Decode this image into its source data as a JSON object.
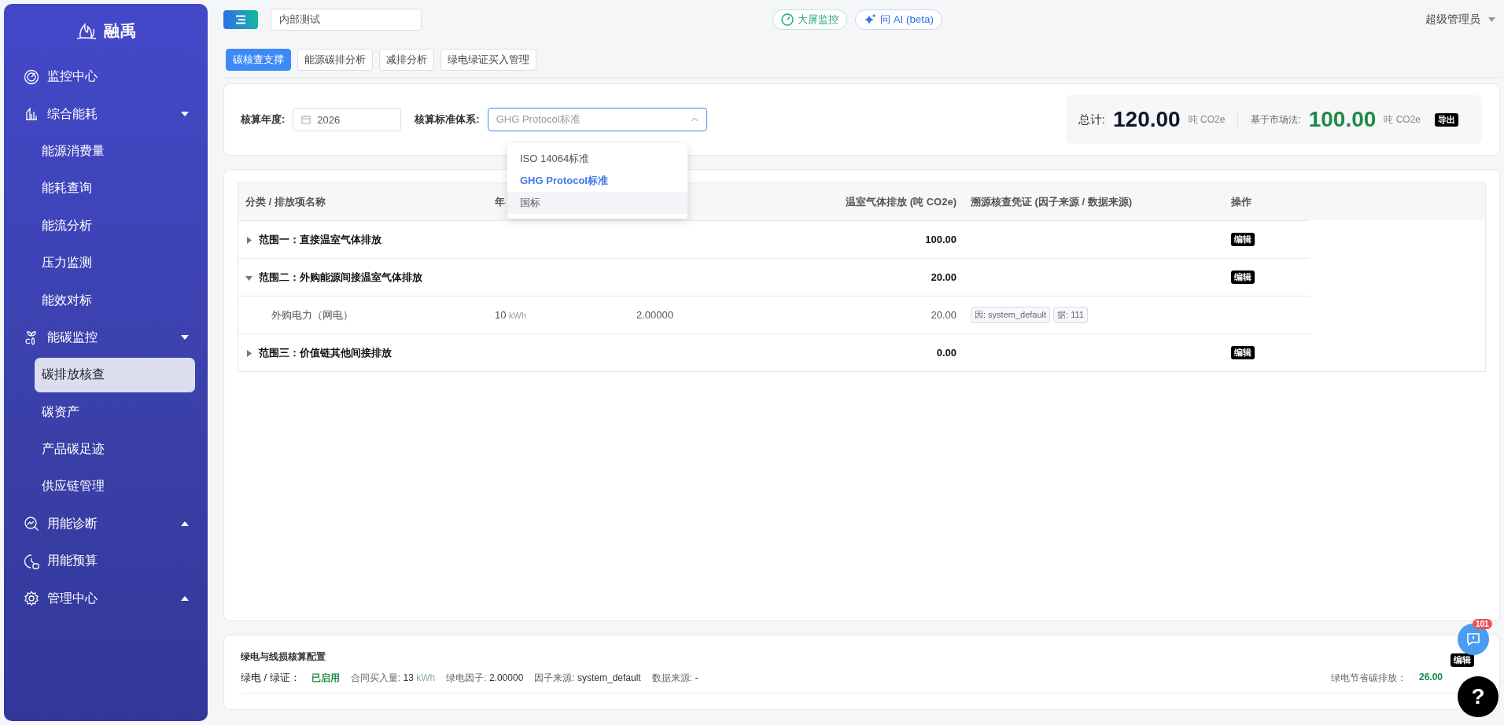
{
  "sidebar": {
    "logo": "融禹",
    "items": [
      {
        "label": "监控中心",
        "kind": "link",
        "selected": false
      },
      {
        "label": "综合能耗",
        "kind": "group",
        "expanded": true,
        "selected": false,
        "children": [
          {
            "label": "能源消费量",
            "selected": false
          },
          {
            "label": "能耗查询",
            "selected": false
          },
          {
            "label": "能流分析",
            "selected": false
          },
          {
            "label": "压力监测",
            "selected": false
          },
          {
            "label": "能效对标",
            "selected": false
          }
        ]
      },
      {
        "label": "能碳监控",
        "kind": "group",
        "expanded": true,
        "selected": false,
        "children": [
          {
            "label": "碳排放核查",
            "selected": true
          },
          {
            "label": "碳资产",
            "selected": false
          },
          {
            "label": "产品碳足迹",
            "selected": false
          },
          {
            "label": "供应链管理",
            "selected": false
          }
        ]
      },
      {
        "label": "用能诊断",
        "kind": "group",
        "expanded": false,
        "selected": false
      },
      {
        "label": "用能预算",
        "kind": "link",
        "selected": false
      },
      {
        "label": "管理中心",
        "kind": "group",
        "expanded": false,
        "selected": false
      }
    ]
  },
  "header": {
    "project_field": {
      "value": "内部测试"
    },
    "buttons": [
      {
        "label": "大屏监控",
        "kind": "screen"
      },
      {
        "label": "问 AI (beta)",
        "kind": "ai"
      }
    ],
    "user": "超级管理员"
  },
  "tabs": [
    {
      "label": "碳核查支撑",
      "selected": true
    },
    {
      "label": "能源碳排分析",
      "selected": false
    },
    {
      "label": "减排分析",
      "selected": false
    },
    {
      "label": "绿电绿证买入管理",
      "selected": false
    }
  ],
  "filters": {
    "year_label": "核算年度:",
    "year": "2026",
    "standard_label": "核算标准体系:",
    "standard": {
      "placeholder": "GHG Protocol标准",
      "open": true,
      "options": [
        {
          "label": "ISO 14064标准",
          "selected": false,
          "highlighted": false
        },
        {
          "label": "GHG Protocol标准",
          "selected": true,
          "highlighted": false
        },
        {
          "label": "国标",
          "selected": false,
          "highlighted": true
        }
      ]
    }
  },
  "summary": {
    "total_label": "总计:",
    "total": "120.00",
    "total_unit": "吨 CO2e",
    "market_label": "基于市场法:",
    "market": "100.00",
    "market_unit": "吨 CO2e",
    "export": "导出"
  },
  "table": {
    "columns": {
      "column_1": "分类 / 排放项名称",
      "column_2": "年",
      "column_4": "温室气体排放 (吨 CO2e)",
      "column_5": "溯源核查凭证 (因子来源 / 数据来源)",
      "column_6": "操作"
    },
    "rows": [
      {
        "name": "范围一：直接温室气体排放",
        "emission": "100.00",
        "action": "编辑",
        "expanded": false
      },
      {
        "name": "范围二：外购能源间接温室气体排放",
        "emission": "20.00",
        "action": "编辑",
        "expanded": true,
        "children": [
          {
            "name": "外购电力（网电）",
            "quantity": "10",
            "unit": "kWh",
            "factor": "2.00000",
            "emission": "20.00",
            "evidence": [
              "因: system_default",
              "据: 111"
            ]
          }
        ]
      },
      {
        "name": "范围三：价值链其他间接排放",
        "emission": "0.00",
        "action": "编辑",
        "expanded": false
      }
    ]
  },
  "green_config": {
    "title": "绿电与线损核算配置",
    "edit": "编辑",
    "fields": [
      {
        "kind": "status",
        "label": "绿电 / 绿证：",
        "value": "已启用"
      },
      {
        "kind": "value",
        "label": "合同买入量:",
        "value": "13",
        "unit": "kWh"
      },
      {
        "kind": "value",
        "label": "绿电因子:",
        "value": "2.00000"
      },
      {
        "kind": "value",
        "label": "因子来源:",
        "value": "system_default"
      },
      {
        "kind": "value",
        "label": "数据来源:",
        "value": "-"
      }
    ],
    "saving_label": "绿电节省碳排放：",
    "saving": "26.00"
  },
  "floating": {
    "chat_badge": "101",
    "help": "?"
  }
}
